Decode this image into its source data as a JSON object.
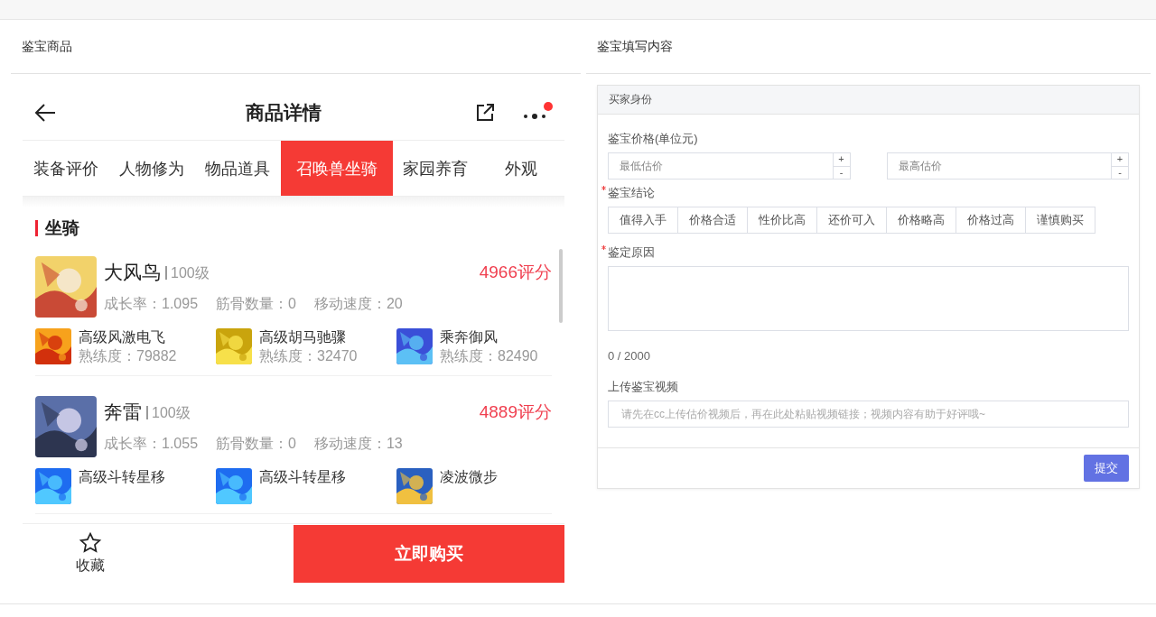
{
  "left_panel": {
    "title": "鉴宝商品"
  },
  "phone": {
    "title": "商品详情",
    "has_notification": true,
    "tabs": [
      {
        "label": "装备评价",
        "selected": false
      },
      {
        "label": "人物修为",
        "selected": false
      },
      {
        "label": "物品道具",
        "selected": false
      },
      {
        "label": "召唤兽坐骑",
        "selected": true
      },
      {
        "label": "家园养育",
        "selected": false
      },
      {
        "label": "外观",
        "selected": false
      }
    ],
    "section_title": "坐骑",
    "mounts": [
      {
        "name": "大风鸟",
        "grade": "100级",
        "score": "4966评分",
        "stats": [
          "成长率：1.095",
          "筋骨数量：0",
          "移动速度：20"
        ],
        "skills": [
          {
            "name": "高级风激电飞",
            "proficiency": "熟练度：79882"
          },
          {
            "name": "高级胡马驰骤",
            "proficiency": "熟练度：32470"
          },
          {
            "name": "乘奔御风",
            "proficiency": "熟练度：82490"
          }
        ]
      },
      {
        "name": "奔雷",
        "grade": "100级",
        "score": "4889评分",
        "stats": [
          "成长率：1.055",
          "筋骨数量：0",
          "移动速度：13"
        ],
        "skills": [
          {
            "name": "高级斗转星移"
          },
          {
            "name": "高级斗转星移"
          },
          {
            "name": "凌波微步"
          }
        ]
      }
    ],
    "favorite_label": "收藏",
    "buy_button": "立即购买"
  },
  "right_panel": {
    "title": "鉴宝填写内容",
    "form": {
      "section": "买家身份",
      "price_label": "鉴宝价格(单位元)",
      "min_placeholder": "最低估价",
      "max_placeholder": "最高估价",
      "increment": "+",
      "decrement": "-",
      "conclusion_label": "鉴宝结论",
      "conclusion_required": true,
      "conclusions": [
        {
          "label": "值得入手",
          "selected": false
        },
        {
          "label": "价格合适",
          "selected": false
        },
        {
          "label": "性价比高",
          "selected": false
        },
        {
          "label": "还价可入",
          "selected": false
        },
        {
          "label": "价格略高",
          "selected": false
        },
        {
          "label": "价格过高",
          "selected": false
        },
        {
          "label": "谨慎购买",
          "selected": false
        }
      ],
      "reason_label": "鉴定原因",
      "reason_required": true,
      "counter": "0 / 2000",
      "video_label": "上传鉴宝视频",
      "video_placeholder": "请先在cc上传估价视频后，再在此处粘贴视频链接；视频内容有助于好评哦~",
      "submit": "提交"
    }
  }
}
